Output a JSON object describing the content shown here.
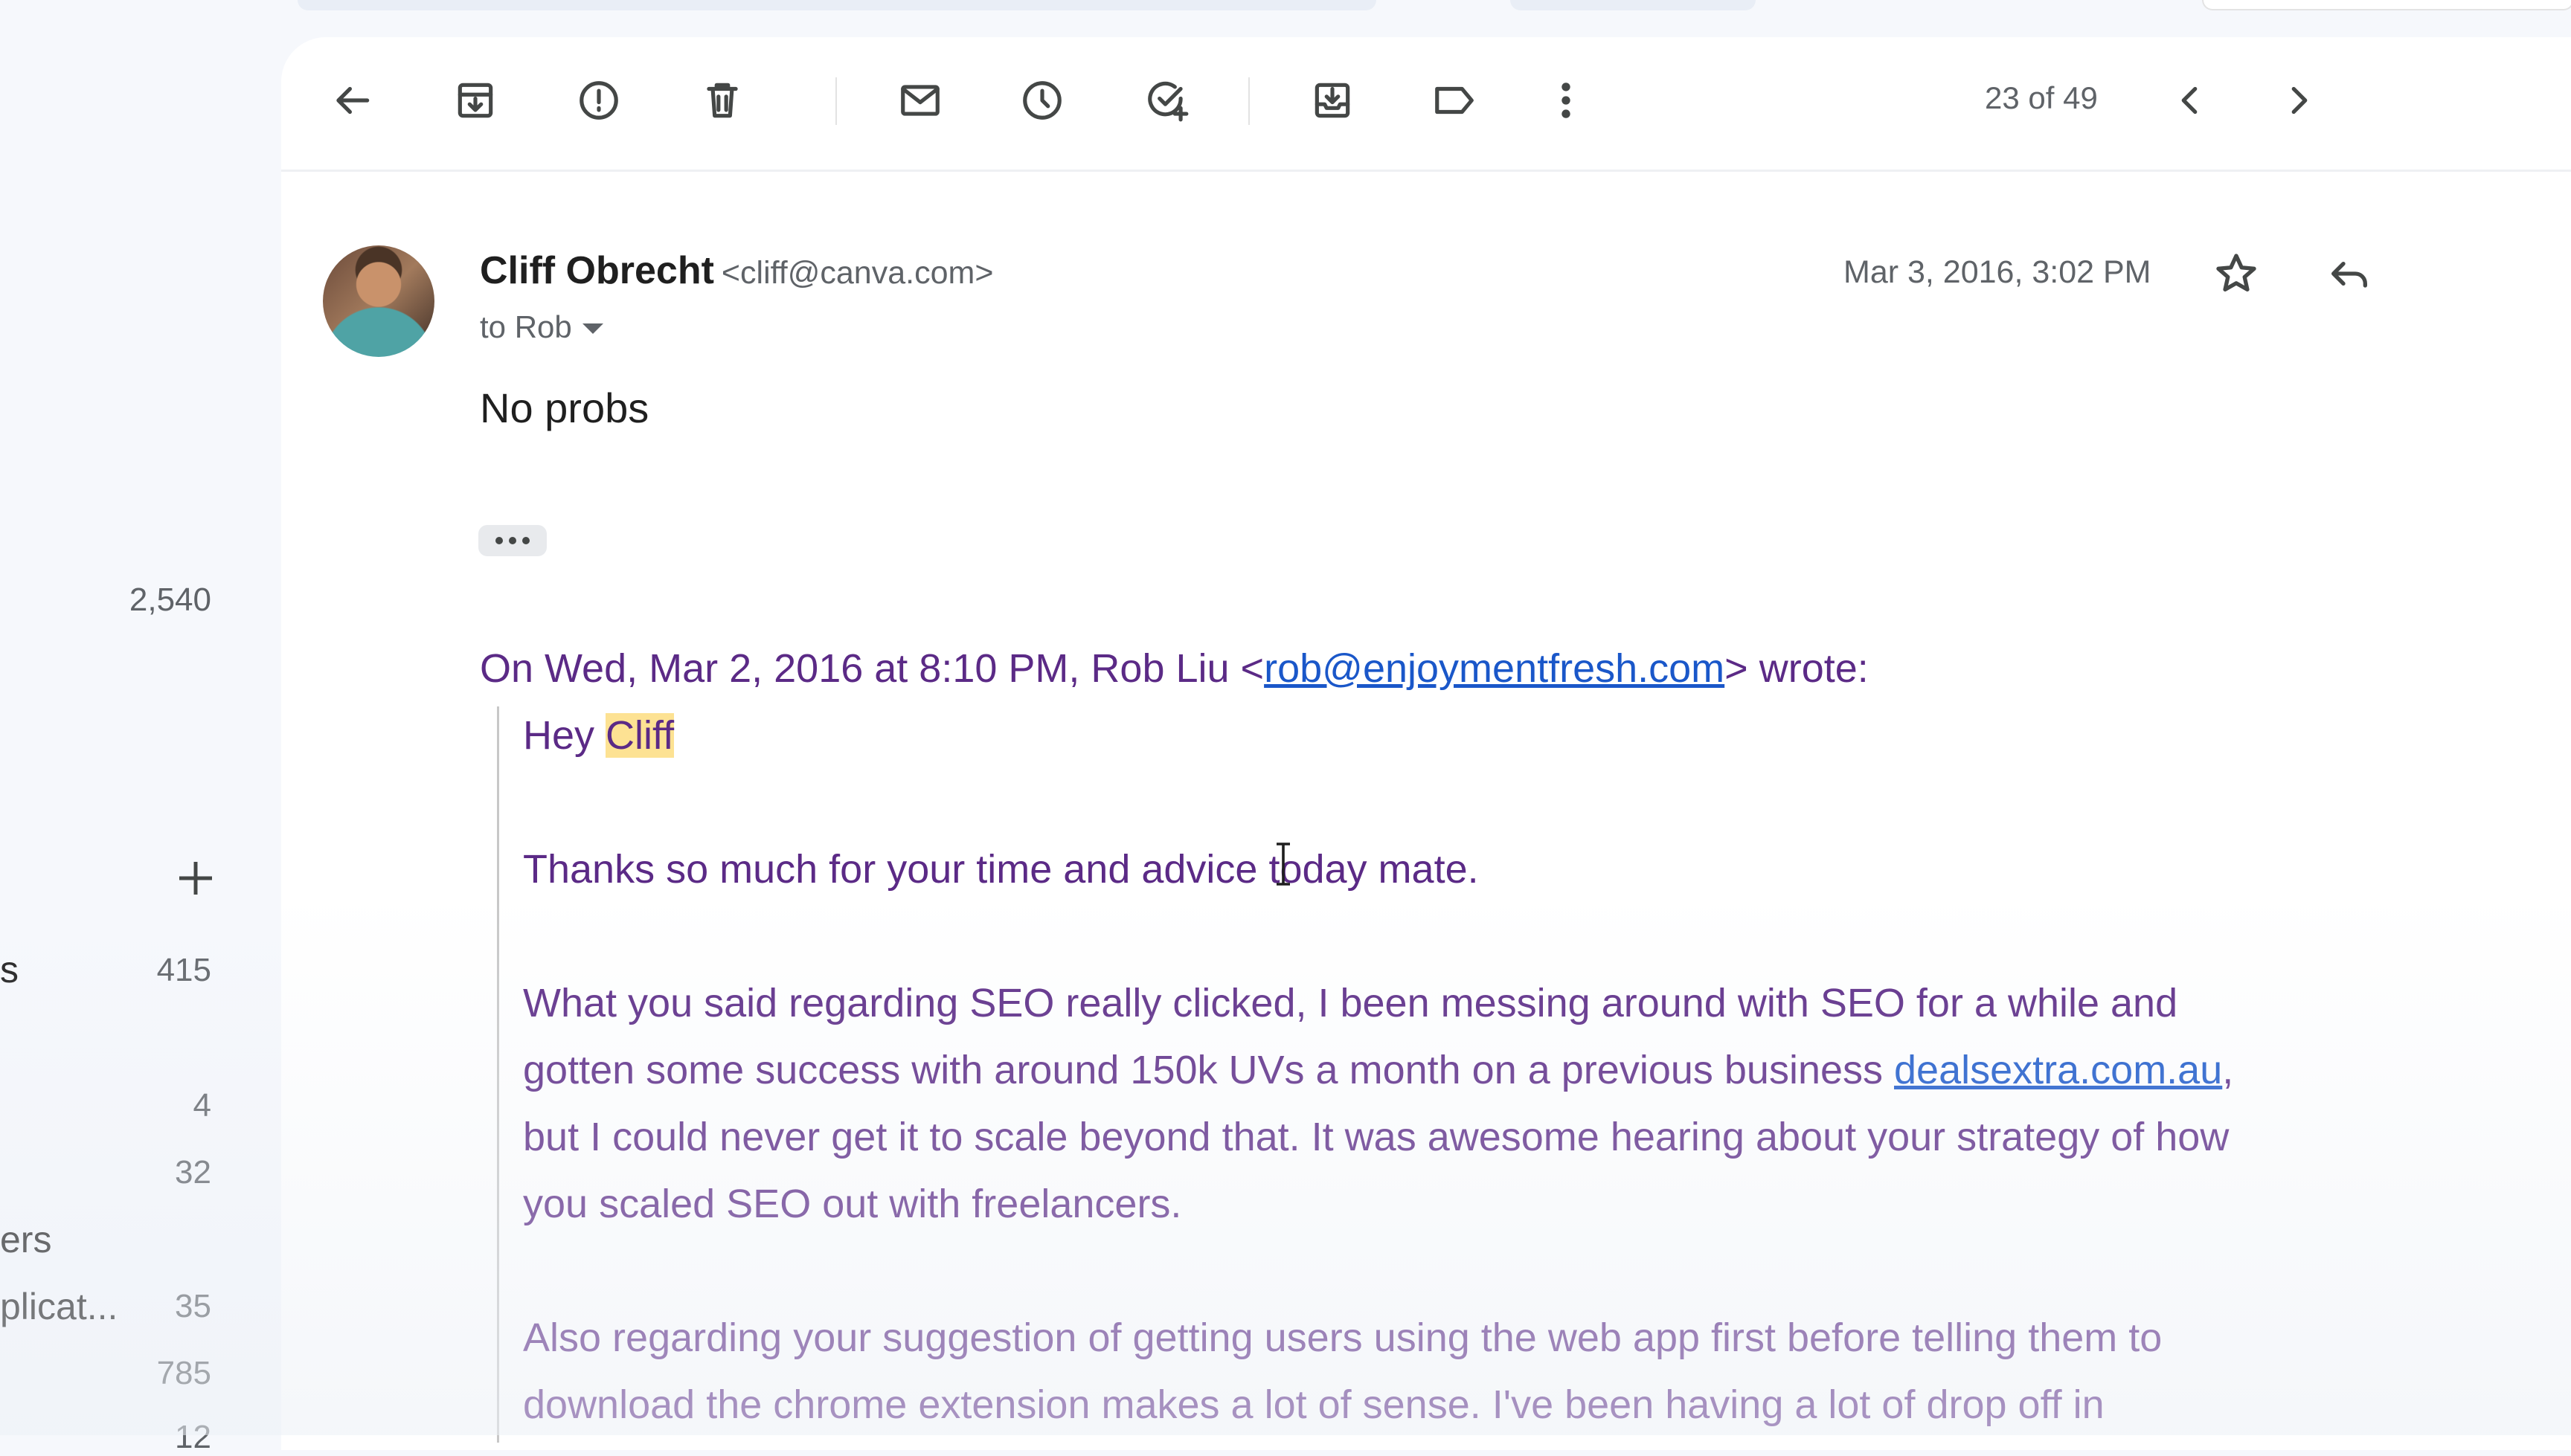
{
  "sidebar": {
    "counts": [
      {
        "label": "",
        "count": "2,540"
      },
      {
        "label": "s",
        "count": "415"
      },
      {
        "label": "",
        "count": "4"
      },
      {
        "label": "",
        "count": "32"
      },
      {
        "label": "ers",
        "count": ""
      },
      {
        "label": "plicat...",
        "count": "35"
      },
      {
        "label": "",
        "count": "785"
      },
      {
        "label": "",
        "count": "12"
      }
    ]
  },
  "toolbar": {
    "buttons": [
      "back-icon",
      "archive-icon",
      "report-spam-icon",
      "delete-icon",
      "mark-unread-icon",
      "snooze-icon",
      "add-task-icon",
      "move-to-icon",
      "label-icon",
      "more-icon"
    ],
    "pager_text": "23 of 49"
  },
  "message": {
    "sender_name": "Cliff Obrecht",
    "sender_email": "<cliff@canva.com>",
    "to": "to Rob",
    "date": "Mar 3, 2016, 3:02 PM",
    "body": "No probs",
    "quote": {
      "attribution_prefix": "On Wed, Mar 2, 2016 at 8:10 PM, Rob Liu <",
      "attribution_email": "rob@enjoymentfresh.com",
      "attribution_suffix": "> wrote:",
      "greeting": "Hey ",
      "greeting_name": "Cliff",
      "para1": "Thanks so much for your time and advice today mate.",
      "para2_line1": "What you said regarding SEO really clicked, I been messing around with SEO for a while and",
      "para2_line2_prefix": "gotten some success with around 150k UVs a month on a previous business ",
      "para2_link": "dealsextra.com.au",
      "para2_line2_suffix": ",",
      "para2_line3": "but I could never get it to scale beyond that. It was awesome hearing about your strategy of how",
      "para2_line4": "you scaled SEO out with freelancers.",
      "para3_line1": "Also regarding your suggestion of getting users using the web app first before telling them to",
      "para3_line2": "download the chrome extension makes a lot of sense. I've been having a lot of drop off in"
    }
  }
}
